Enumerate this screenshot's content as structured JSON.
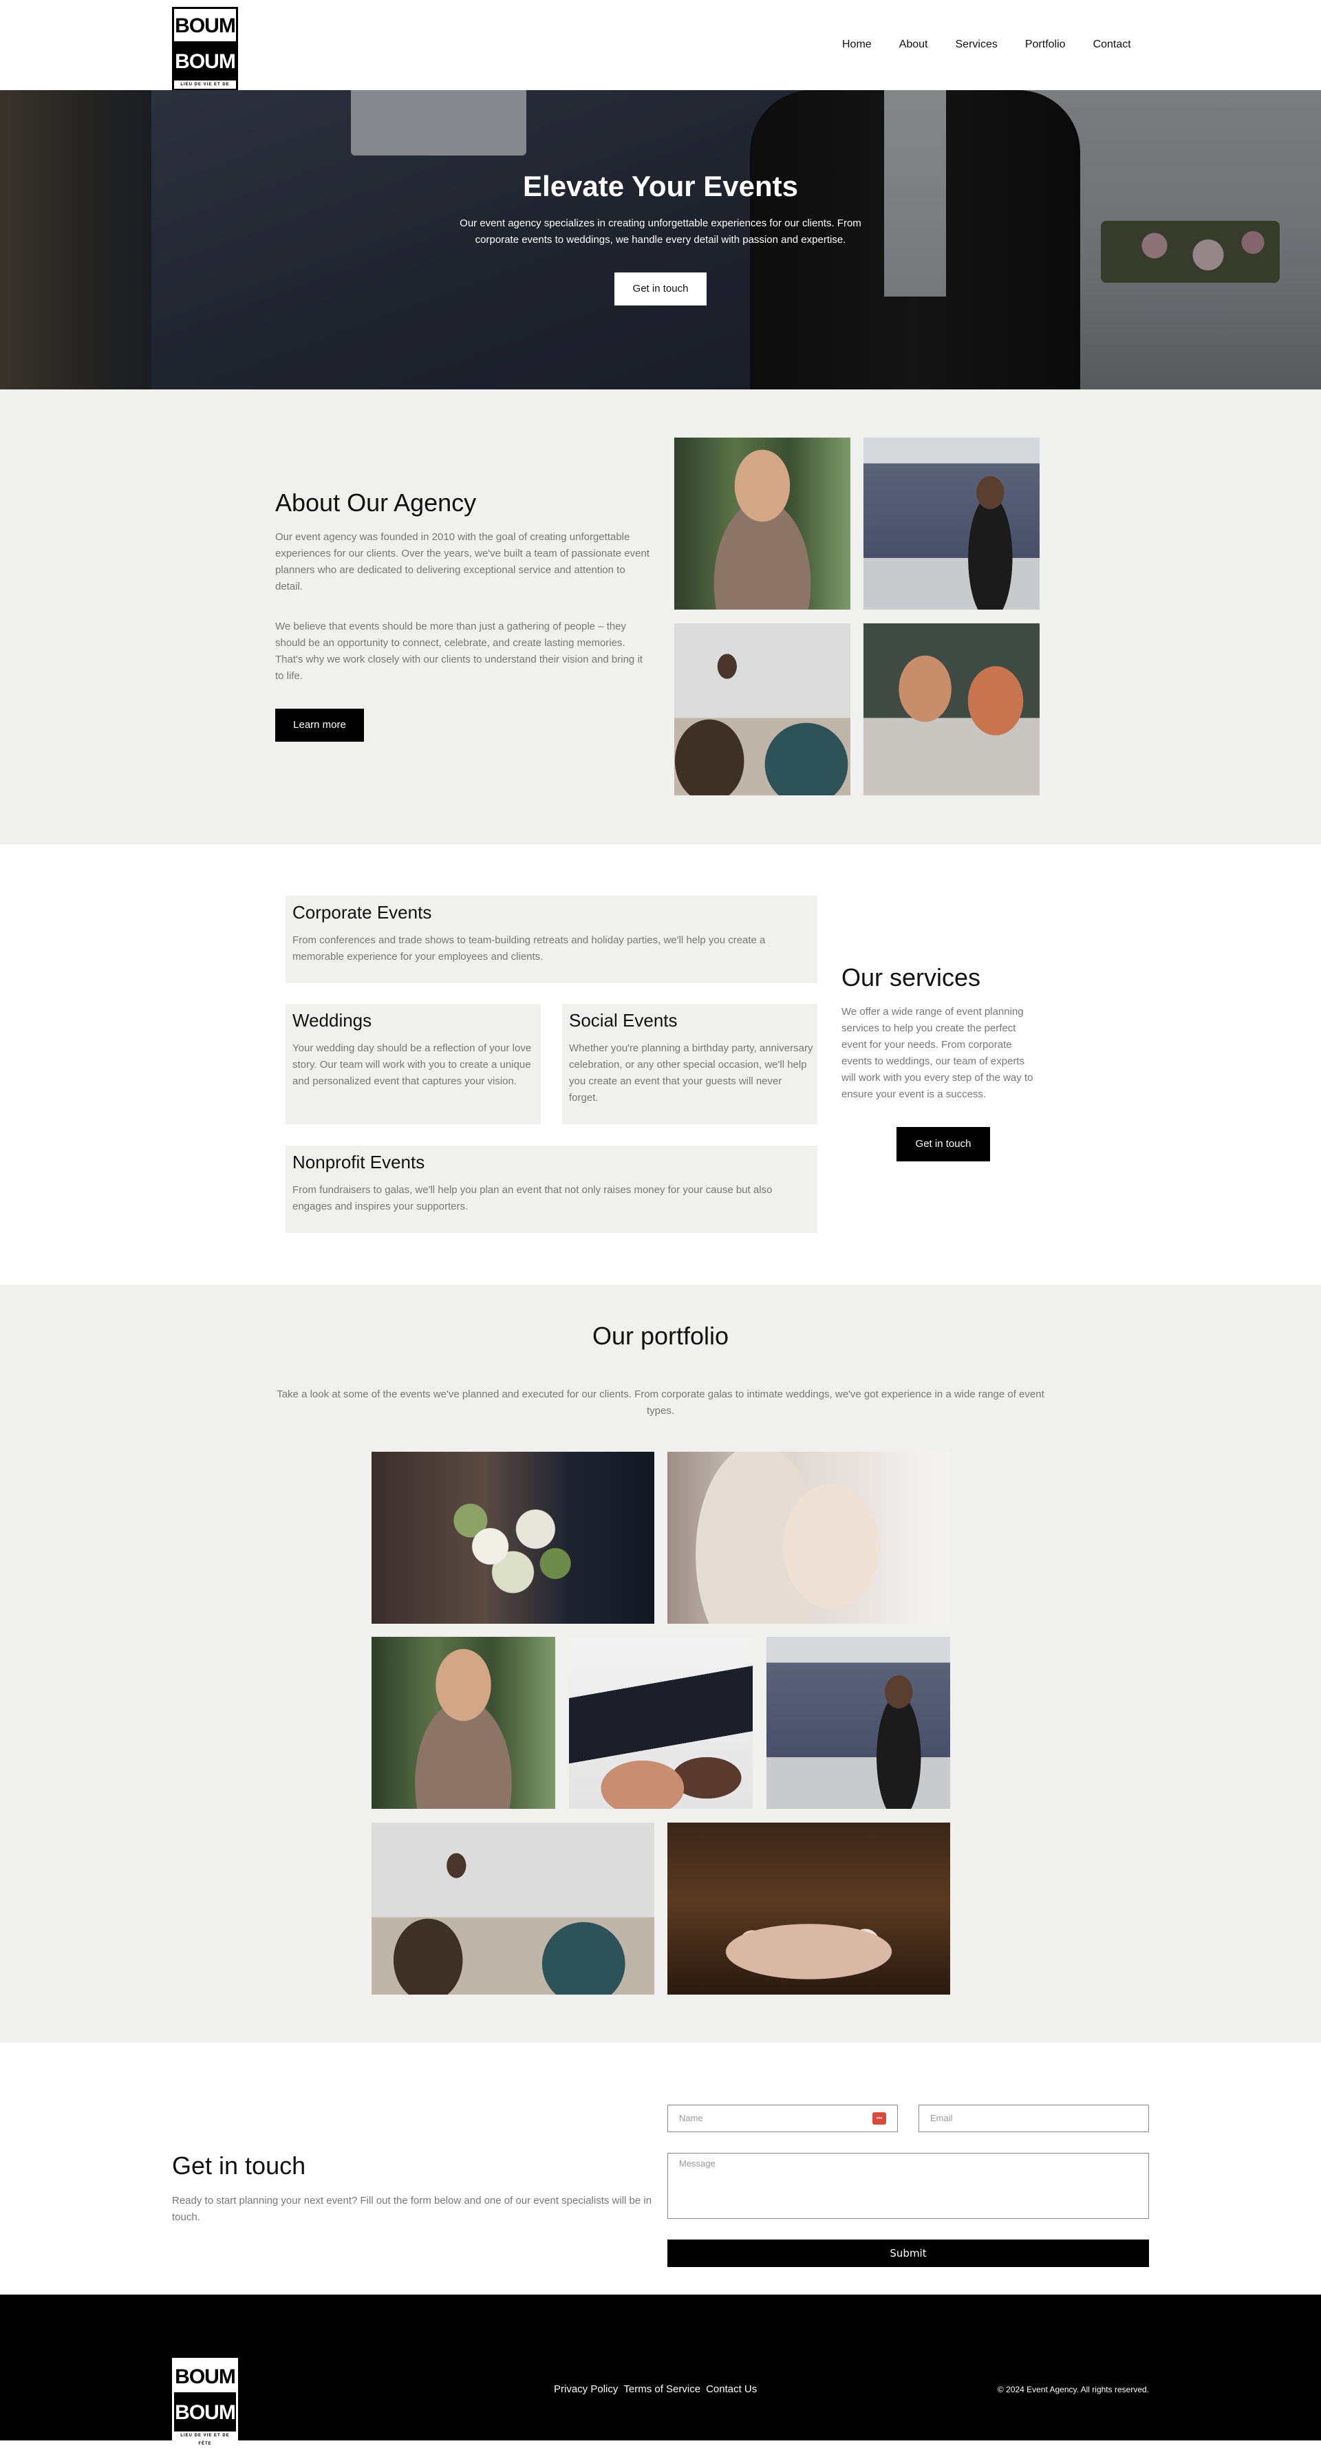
{
  "header": {
    "logo": {
      "line1": "BOUM",
      "line2": "BOUM",
      "tagline": "LIEU DE VIE ET DE FÊTE"
    },
    "nav": [
      "Home",
      "About",
      "Services",
      "Portfolio",
      "Contact"
    ]
  },
  "hero": {
    "title": "Elevate Your Events",
    "description": "Our event agency specializes in creating unforgettable experiences for our clients. From corporate events to weddings, we handle every detail with passion and expertise.",
    "cta": "Get in touch"
  },
  "about": {
    "title": "About Our Agency",
    "paragraph1": "Our event agency was founded in 2010 with the goal of creating unforgettable experiences for our clients. Over the years, we've built a team of passionate event planners who are dedicated to delivering exceptional service and attention to detail.",
    "paragraph2": "We believe that events should be more than just a gathering of people – they should be an opportunity to connect, celebrate, and create lasting memories. That's why we work closely with our clients to understand their vision and bring it to life.",
    "cta": "Learn more"
  },
  "services": {
    "title": "Our services",
    "description": "We offer a wide range of event planning services to help you create the perfect event for your needs. From corporate events to weddings, our team of experts will work with you every step of the way to ensure your event is a success.",
    "cta": "Get in touch",
    "cards": [
      {
        "title": "Corporate Events",
        "text": "From conferences and trade shows to team-building retreats and holiday parties, we'll help you create a memorable experience for your employees and clients."
      },
      {
        "title": "Weddings",
        "text": "Your wedding day should be a reflection of your love story. Our team will work with you to create a unique and personalized event that captures your vision."
      },
      {
        "title": "Social Events",
        "text": "Whether you're planning a birthday party, anniversary celebration, or any other special occasion, we'll help you create an event that your guests will never forget."
      },
      {
        "title": "Nonprofit Events",
        "text": "From fundraisers to galas, we'll help you plan an event that not only raises money for your cause but also engages and inspires your supporters."
      }
    ]
  },
  "portfolio": {
    "title": "Our portfolio",
    "description": "Take a look at some of the events we've planned and executed for our clients. From corporate galas to intimate weddings, we've got experience in a wide range of event types."
  },
  "contact": {
    "title": "Get in touch",
    "description": "Ready to start planning your next event? Fill out the form below and one of our event specialists will be in touch.",
    "name_placeholder": "Name",
    "email_placeholder": "Email",
    "message_placeholder": "Message",
    "autofill_icon": "•••",
    "submit": "Submit"
  },
  "footer": {
    "links": [
      "Privacy Policy",
      "Terms of Service",
      "Contact Us"
    ],
    "copyright": "© 2024 Event Agency. All rights reserved."
  }
}
